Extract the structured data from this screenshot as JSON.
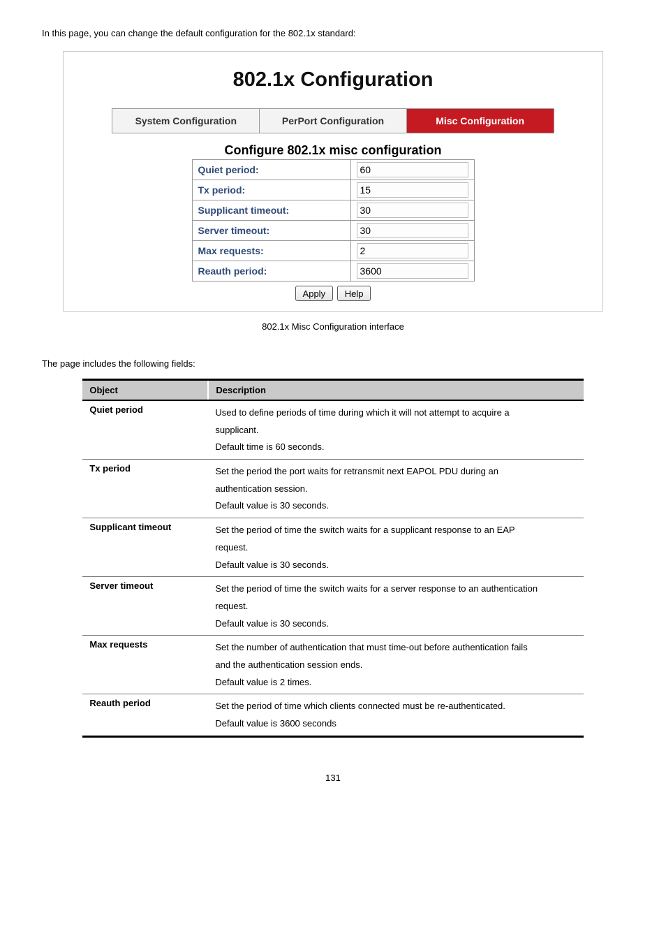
{
  "intro_text": "In this page, you can change the default configuration for the 802.1x standard:",
  "figure": {
    "title": "802.1x Configuration",
    "tabs": [
      {
        "label": "System Configuration",
        "active": false
      },
      {
        "label": "PerPort Configuration",
        "active": false
      },
      {
        "label": "Misc Configuration",
        "active": true
      }
    ],
    "section_heading": "Configure 802.1x misc configuration",
    "rows": [
      {
        "label": "Quiet period:",
        "value": "60"
      },
      {
        "label": "Tx period:",
        "value": "15"
      },
      {
        "label": "Supplicant timeout:",
        "value": "30"
      },
      {
        "label": "Server timeout:",
        "value": "30"
      },
      {
        "label": "Max requests:",
        "value": "2"
      },
      {
        "label": "Reauth period:",
        "value": "3600"
      }
    ],
    "buttons": {
      "apply": "Apply",
      "help": "Help"
    },
    "caption": "802.1x Misc Configuration interface"
  },
  "fields_intro": "The page includes the following fields:",
  "desc_header": {
    "object": "Object",
    "description": "Description"
  },
  "desc_rows": [
    {
      "object": "Quiet period",
      "lines": [
        "Used to define periods of time during which it will not attempt to acquire a",
        "supplicant.",
        "Default time is 60 seconds."
      ]
    },
    {
      "object": "Tx period",
      "lines": [
        "Set the period the port waits for retransmit next EAPOL PDU during an",
        "authentication session.",
        "Default value is 30 seconds."
      ]
    },
    {
      "object": "Supplicant timeout",
      "lines": [
        "Set the period of time the switch waits for a supplicant response to an EAP",
        "request.",
        "Default value is 30 seconds."
      ]
    },
    {
      "object": "Server timeout",
      "lines": [
        "Set the period of time the switch waits for a server response to an authentication",
        "request.",
        "Default value is 30 seconds."
      ]
    },
    {
      "object": "Max requests",
      "lines": [
        "Set the number of authentication that must time-out before authentication fails",
        "and the authentication session ends.",
        "Default value is 2 times."
      ]
    },
    {
      "object": "Reauth period",
      "lines": [
        "Set the period of time which clients connected must be re-authenticated.",
        "Default value is 3600 seconds"
      ]
    }
  ],
  "page_number": "131"
}
